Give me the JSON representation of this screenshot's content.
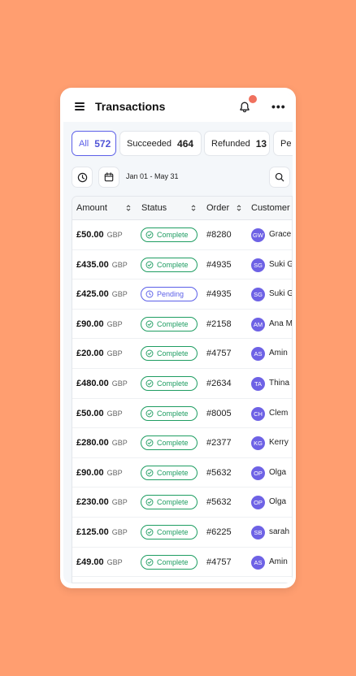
{
  "header": {
    "title": "Transactions",
    "menu_icon": "hamburger-menu-icon",
    "notification_icon": "bell-icon",
    "more_icon": "more-horizontal-icon",
    "more_label": "•••"
  },
  "tabs": [
    {
      "label": "All",
      "count": "572",
      "active": true
    },
    {
      "label": "Succeeded",
      "count": "464",
      "active": false
    },
    {
      "label": "Refunded",
      "count": "13",
      "active": false
    },
    {
      "label": "Pe",
      "count": "",
      "active": false
    }
  ],
  "toolbar": {
    "clock_icon": "clock-icon",
    "calendar_icon": "calendar-icon",
    "date_range": "Jan 01 - May 31",
    "search_icon": "search-icon"
  },
  "table": {
    "columns": [
      "Amount",
      "Status",
      "Order",
      "Customer"
    ],
    "rows": [
      {
        "amount": "£50.00",
        "currency": "GBP",
        "status": "Complete",
        "order": "#8280",
        "initials": "GW",
        "customer": "Grace"
      },
      {
        "amount": "£435.00",
        "currency": "GBP",
        "status": "Complete",
        "order": "#4935",
        "initials": "SG",
        "customer": "Suki G"
      },
      {
        "amount": "£425.00",
        "currency": "GBP",
        "status": "Pending",
        "order": "#4935",
        "initials": "SG",
        "customer": "Suki G"
      },
      {
        "amount": "£90.00",
        "currency": "GBP",
        "status": "Complete",
        "order": "#2158",
        "initials": "AM",
        "customer": "Ana M"
      },
      {
        "amount": "£20.00",
        "currency": "GBP",
        "status": "Complete",
        "order": "#4757",
        "initials": "AS",
        "customer": "Amin"
      },
      {
        "amount": "£480.00",
        "currency": "GBP",
        "status": "Complete",
        "order": "#2634",
        "initials": "TA",
        "customer": "Thina"
      },
      {
        "amount": "£50.00",
        "currency": "GBP",
        "status": "Complete",
        "order": "#8005",
        "initials": "CH",
        "customer": "Clem"
      },
      {
        "amount": "£280.00",
        "currency": "GBP",
        "status": "Complete",
        "order": "#2377",
        "initials": "KG",
        "customer": "Kerry"
      },
      {
        "amount": "£90.00",
        "currency": "GBP",
        "status": "Complete",
        "order": "#5632",
        "initials": "OP",
        "customer": "Olga"
      },
      {
        "amount": "£230.00",
        "currency": "GBP",
        "status": "Complete",
        "order": "#5632",
        "initials": "OP",
        "customer": "Olga"
      },
      {
        "amount": "£125.00",
        "currency": "GBP",
        "status": "Complete",
        "order": "#6225",
        "initials": "SB",
        "customer": "sarah"
      },
      {
        "amount": "£49.00",
        "currency": "GBP",
        "status": "Complete",
        "order": "#4757",
        "initials": "AS",
        "customer": "Amin"
      }
    ]
  },
  "colors": {
    "background": "#FF9E70",
    "accent": "#5B5FE8",
    "success": "#1F9D62",
    "avatar": "#6E62E5",
    "notification_dot": "#F0715E"
  }
}
